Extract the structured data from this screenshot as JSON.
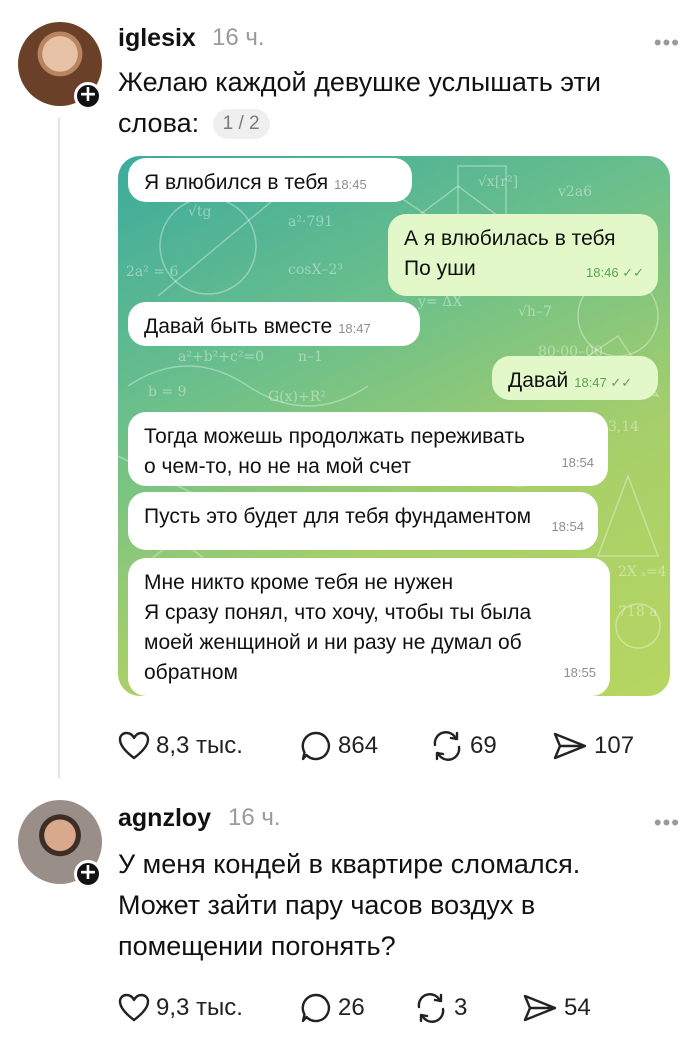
{
  "posts": [
    {
      "username": "iglesix",
      "time": "16 ч.",
      "more": "•••",
      "text": "Желаю каждой девушке услышать эти слова:",
      "counter": "1 / 2",
      "screenshot": {
        "messages": [
          {
            "text": "Я влюбился в тебя",
            "time": "18:45",
            "side": "in"
          },
          {
            "text_lines": [
              "А я влюбилась в тебя",
              "По уши"
            ],
            "time": "18:46",
            "side": "out"
          },
          {
            "text": "Давай быть вместе",
            "time": "18:47",
            "side": "in"
          },
          {
            "text": "Давай",
            "time": "18:47",
            "side": "out"
          },
          {
            "text_lines": [
              "Тогда можешь продолжать переживать",
              "о чем-то, но не на мой счет"
            ],
            "time": "18:54",
            "side": "in"
          },
          {
            "text": "Пусть это будет для тебя фундаментом",
            "time": "18:54",
            "side": "in"
          },
          {
            "text_lines": [
              "Мне никто кроме тебя не нужен",
              "Я сразу понял, что хочу, чтобы ты была",
              "моей женщиной и ни разу не думал об",
              "обратном"
            ],
            "time": "18:55",
            "side": "in"
          }
        ]
      },
      "stats": {
        "likes": "8,3 тыс.",
        "comments": "864",
        "reposts": "69",
        "shares": "107"
      }
    },
    {
      "username": "agnzloy",
      "time": "16 ч.",
      "more": "•••",
      "text": "У меня кондей в квартире сломался. Может зайти пару часов воздух в помещении погонять?",
      "stats": {
        "likes": "9,3 тыс.",
        "comments": "26",
        "reposts": "3",
        "shares": "54"
      }
    }
  ],
  "ui": {
    "plus": "+",
    "read_check": "✓✓"
  },
  "icons": [
    "heart-icon",
    "comment-icon",
    "repost-icon",
    "share-icon",
    "plus-icon"
  ]
}
